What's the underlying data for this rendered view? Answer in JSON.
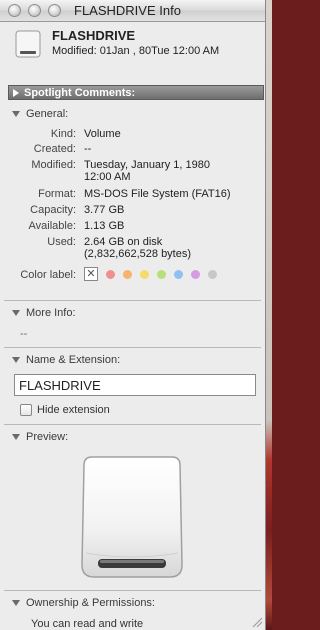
{
  "window": {
    "title": "FLASHDRIVE Info"
  },
  "header": {
    "name": "FLASHDRIVE",
    "modified": "Modified: 01Jan , 80Tue 12:00 AM"
  },
  "spotlight": {
    "label": "Spotlight Comments:"
  },
  "general": {
    "label": "General:",
    "rows": [
      {
        "label": "Kind:",
        "value": "Volume"
      },
      {
        "label": "Created:",
        "value": "--"
      },
      {
        "label": "Modified:",
        "value": "Tuesday, January 1, 1980"
      },
      {
        "label": "",
        "value": "12:00 AM"
      },
      {
        "label": "Format:",
        "value": "MS-DOS File System (FAT16)"
      },
      {
        "label": "Capacity:",
        "value": "3.77 GB"
      },
      {
        "label": "Available:",
        "value": "1.13 GB"
      },
      {
        "label": "Used:",
        "value": "2.64 GB on disk"
      },
      {
        "label": "",
        "value": "(2,832,662,528 bytes)"
      }
    ],
    "color_label": "Color label:",
    "color_none": "✕",
    "colors": [
      "#f08f8f",
      "#f6b46f",
      "#f3dc6a",
      "#b8e07a",
      "#8fc0f2",
      "#d59be3",
      "#c8c8c8"
    ]
  },
  "more_info": {
    "label": "More Info:",
    "value": "--"
  },
  "name_ext": {
    "label": "Name & Extension:",
    "field_value": "FLASHDRIVE",
    "hide_ext": "Hide extension"
  },
  "preview": {
    "label": "Preview:"
  },
  "ownership": {
    "label": "Ownership & Permissions:",
    "text": "You can read and write"
  }
}
